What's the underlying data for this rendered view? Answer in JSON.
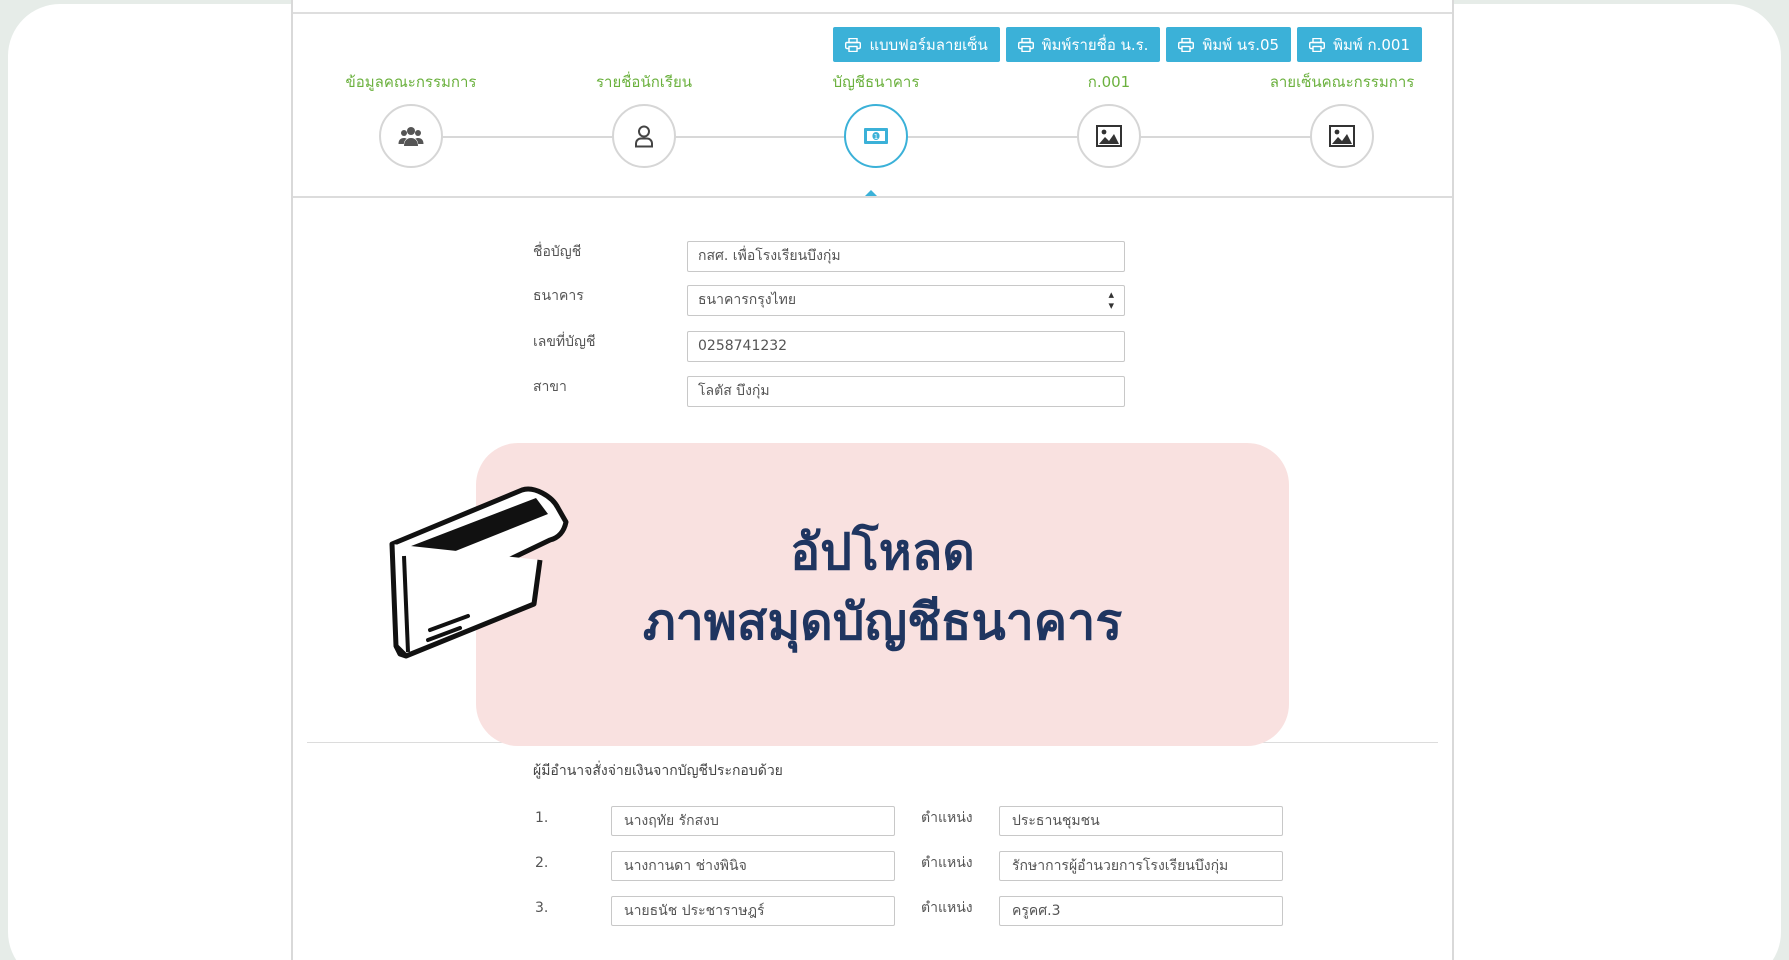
{
  "toolbar": {
    "buttons": [
      {
        "label": "แบบฟอร์มลายเซ็น",
        "icon": "printer-icon"
      },
      {
        "label": "พิมพ์รายชื่อ น.ร.",
        "icon": "printer-icon"
      },
      {
        "label": "พิมพ์ นร.05",
        "icon": "printer-icon"
      },
      {
        "label": "พิมพ์ ก.001",
        "icon": "printer-icon"
      }
    ]
  },
  "steps": [
    {
      "label": "ข้อมูลคณะกรรมการ",
      "icon": "users-icon",
      "active": false
    },
    {
      "label": "รายชื่อนักเรียน",
      "icon": "user-icon",
      "active": false
    },
    {
      "label": "บัญชีธนาคาร",
      "icon": "money-icon",
      "active": true
    },
    {
      "label": "ก.001",
      "icon": "image-icon",
      "active": false
    },
    {
      "label": "ลายเซ็นคณะกรรมการ",
      "icon": "image-icon",
      "active": false
    }
  ],
  "account": {
    "name_label": "ชื่อบัญชี",
    "name_value": "กสศ. เพื่อโรงเรียนบึงกุ่ม",
    "bank_label": "ธนาคาร",
    "bank_value": "ธนาคารกรุงไทย",
    "number_label": "เลขที่บัญชี",
    "number_value": "0258741232",
    "branch_label": "สาขา",
    "branch_value": "โลตัส บึงกุ่ม"
  },
  "authorized": {
    "title": "ผู้มีอำนาจสั่งจ่ายเงินจากบัญชีประกอบด้วย",
    "position_label": "ตำแหน่ง",
    "rows": [
      {
        "num": "1.",
        "name": "นางฤทัย รักสงบ",
        "position": "ประธานชุมชน"
      },
      {
        "num": "2.",
        "name": "นางกานดา ช่างพินิจ",
        "position": "รักษาการผู้อำนวยการโรงเรียนบึงกุ่ม"
      },
      {
        "num": "3.",
        "name": "นายธนัช ประชาราษฎร์",
        "position": "ครูคศ.3"
      }
    ]
  },
  "overlay": {
    "line1": "อัปโหลด",
    "line2": "ภาพสมุดบัญชีธนาคาร",
    "icon": "passbook-icon"
  }
}
